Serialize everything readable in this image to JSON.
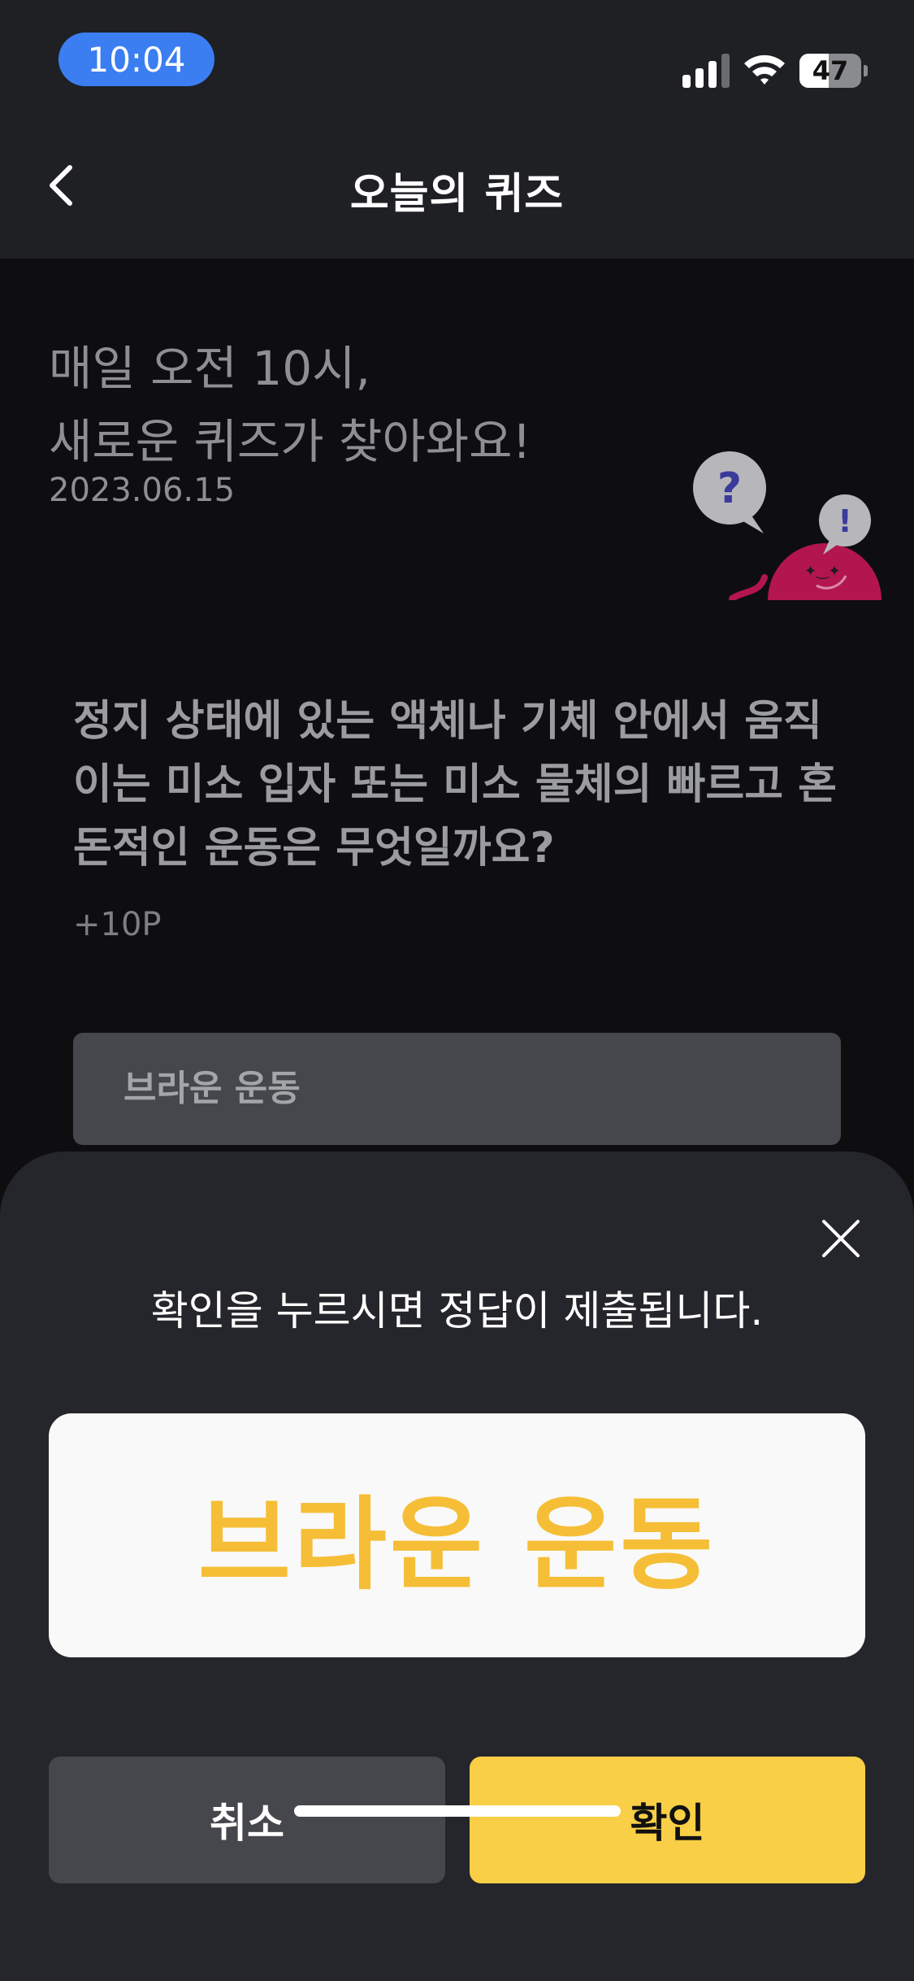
{
  "status_bar": {
    "time": "10:04",
    "battery_level": "47",
    "icons": [
      "signal-icon",
      "wifi-icon",
      "battery-icon"
    ]
  },
  "header": {
    "title": "오늘의 퀴즈",
    "back_icon": "chevron-left-icon"
  },
  "quiz": {
    "intro_line1": "매일 오전 10시,",
    "intro_line2": "새로운 퀴즈가 찾아와요!",
    "date": "2023.06.15",
    "mascot_icon": "quiz-mascot-icon",
    "question": "정지 상태에 있는 액체나 기체 안에서 움직이는 미소 입자 또는 미소 물체의 빠르고 혼돈적인 운동은 무엇일까요?",
    "points": "+10P",
    "answer_value": "브라운 운동"
  },
  "confirm_sheet": {
    "message": "확인을 누르시면 정답이 제출됩니다.",
    "answer": "브라운 운동",
    "cancel_label": "취소",
    "confirm_label": "확인",
    "close_icon": "close-icon"
  },
  "colors": {
    "time_pill": "#3b7ef2",
    "answer_accent": "#f5be36",
    "confirm_button": "#f8cf46",
    "mascot": "#b3154f"
  }
}
